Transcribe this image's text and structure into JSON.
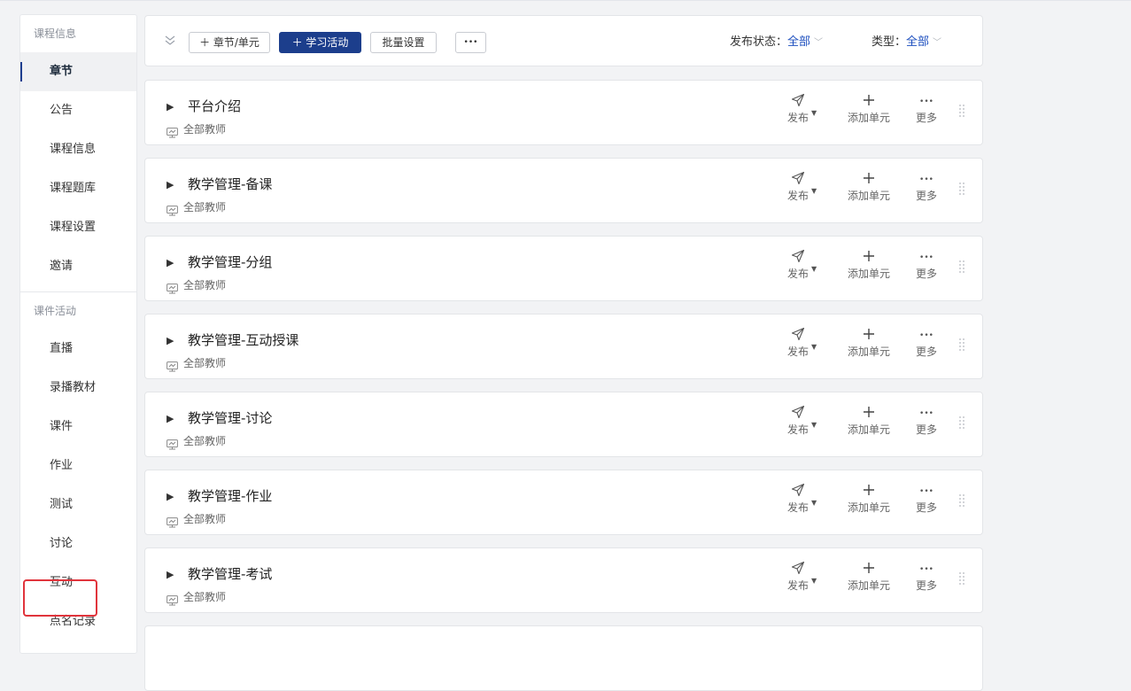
{
  "sidebar": {
    "group1": "课程信息",
    "items1": [
      "章节",
      "公告",
      "课程信息",
      "课程题库",
      "课程设置",
      "邀请"
    ],
    "group2": "课件活动",
    "items2": [
      "直播",
      "录播教材",
      "课件",
      "作业",
      "测试",
      "讨论",
      "互动",
      "点名记录"
    ]
  },
  "toolbar": {
    "add_chapter_label": "＋ 章节/单元",
    "add_activity_label": "＋ 学习活动",
    "batch_label": "批量设置",
    "more_label": "•••",
    "status_label": "发布状态：",
    "status_value": "全部",
    "type_label": "类型：",
    "type_value": "全部"
  },
  "chapters": [
    {
      "title": "平台介绍",
      "audience": "全部教师"
    },
    {
      "title": "教学管理-备课",
      "audience": "全部教师"
    },
    {
      "title": "教学管理-分组",
      "audience": "全部教师"
    },
    {
      "title": "教学管理-互动授课",
      "audience": "全部教师"
    },
    {
      "title": "教学管理-讨论",
      "audience": "全部教师"
    },
    {
      "title": "教学管理-作业",
      "audience": "全部教师"
    },
    {
      "title": "教学管理-考试",
      "audience": "全部教师"
    }
  ],
  "actions": {
    "publish": "发布",
    "add_unit": "添加单元",
    "more": "更多",
    "more_glyph": "•••"
  },
  "colors": {
    "accent": "#1c3e8c",
    "link": "#1d4fbf",
    "highlight": "#e0343c"
  }
}
